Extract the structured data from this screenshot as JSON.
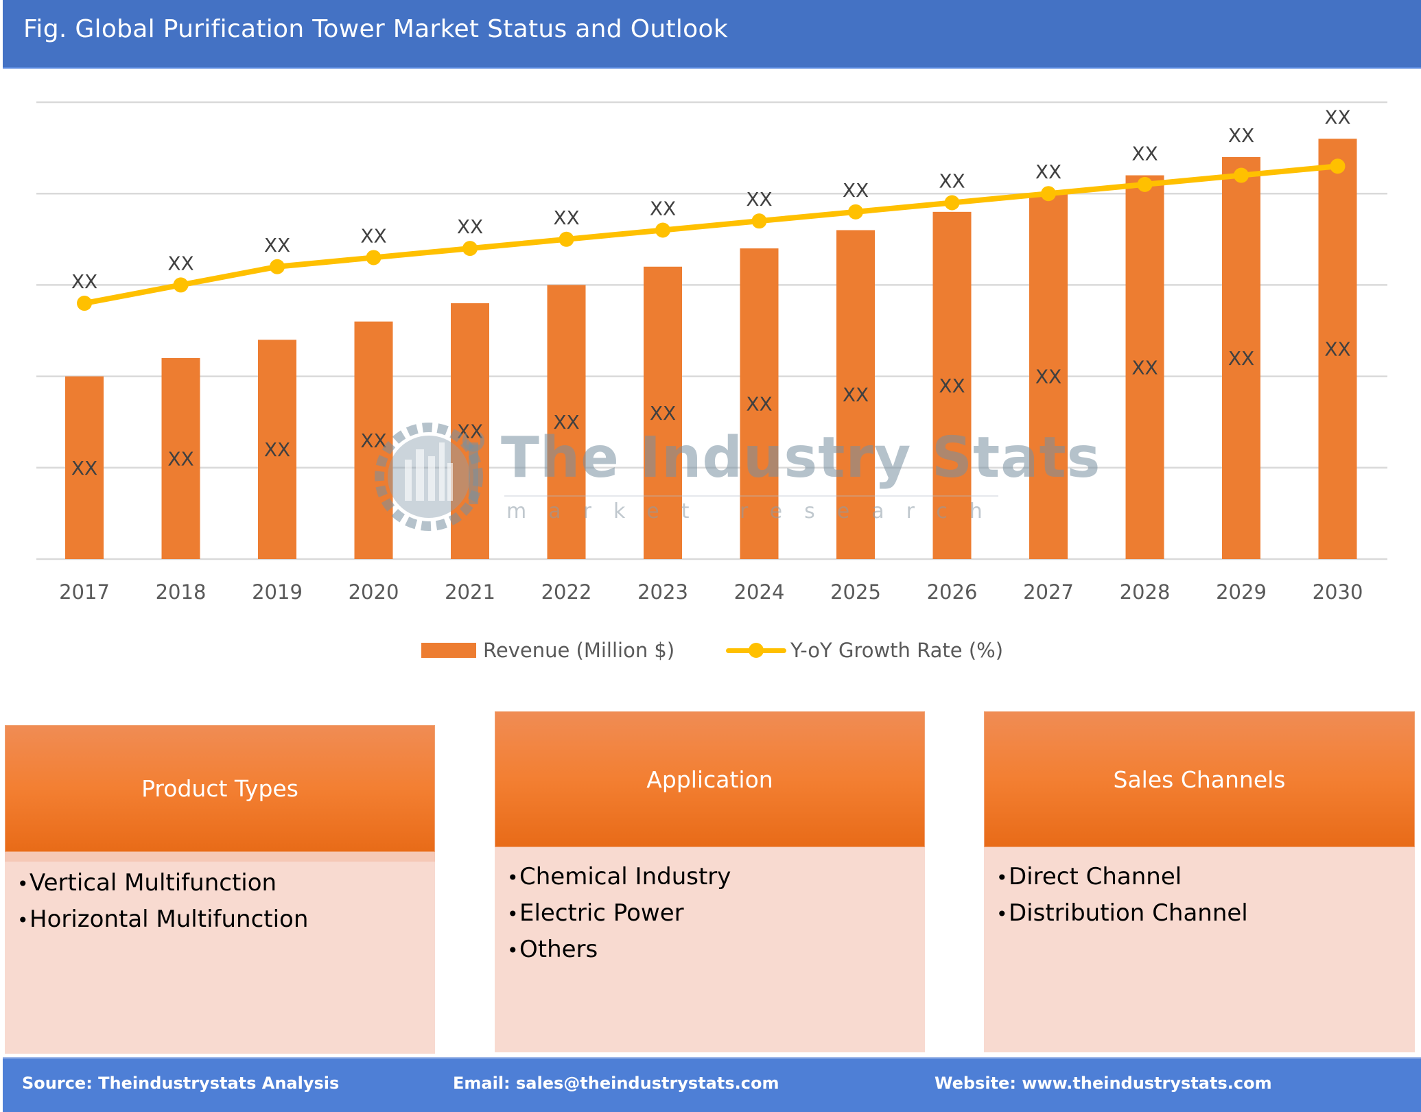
{
  "header": {
    "title": "Fig. Global Purification Tower Market Status and Outlook"
  },
  "chart_data": {
    "type": "bar",
    "title": "Fig. Global Purification Tower Market Status and Outlook",
    "xlabel": "",
    "ylabel": "",
    "categories": [
      "2017",
      "2018",
      "2019",
      "2020",
      "2021",
      "2022",
      "2023",
      "2024",
      "2025",
      "2026",
      "2027",
      "2028",
      "2029",
      "2030"
    ],
    "ylim": [
      0,
      5
    ],
    "grid": true,
    "gridline_count": 6,
    "legend_position": "bottom",
    "series": [
      {
        "name": "Revenue (Million $)",
        "type": "bar",
        "color": "#ed7d31",
        "values": [
          2.0,
          2.2,
          2.4,
          2.6,
          2.8,
          3.0,
          3.2,
          3.4,
          3.6,
          3.8,
          4.0,
          4.2,
          4.4,
          4.6
        ],
        "data_labels": [
          "XX",
          "XX",
          "XX",
          "XX",
          "XX",
          "XX",
          "XX",
          "XX",
          "XX",
          "XX",
          "XX",
          "XX",
          "XX",
          "XX"
        ]
      },
      {
        "name": "Y-oY Growth Rate (%)",
        "type": "line",
        "color": "#ffc000",
        "values": [
          2.8,
          3.0,
          3.2,
          3.3,
          3.4,
          3.5,
          3.6,
          3.7,
          3.8,
          3.9,
          4.0,
          4.1,
          4.2,
          4.3
        ],
        "data_labels": [
          "XX",
          "XX",
          "XX",
          "XX",
          "XX",
          "XX",
          "XX",
          "XX",
          "XX",
          "XX",
          "XX",
          "XX",
          "XX",
          "XX"
        ]
      }
    ],
    "note": "Values are relative estimates read from gridlines; the chart prints placeholder labels 'XX' instead of numbers and shows no y-axis tick labels."
  },
  "watermark": {
    "title": "The Industry Stats",
    "subtitle": "market research",
    "icon": "gear-wrench-factory-icon"
  },
  "segments": [
    {
      "title": "Product Types",
      "items": [
        "Vertical Multifunction",
        "Horizontal Multifunction"
      ]
    },
    {
      "title": "Application",
      "items": [
        "Chemical Industry",
        "Electric Power",
        "Others"
      ]
    },
    {
      "title": "Sales Channels",
      "items": [
        "Direct Channel",
        "Distribution Channel"
      ]
    }
  ],
  "bullet": "•",
  "footer": {
    "source": "Source: Theindustrystats Analysis",
    "email": "Email: sales@theindustrystats.com",
    "website": "Website: www.theindustrystats.com"
  },
  "colors": {
    "header_bg": "#4472c4",
    "footer_bg": "#4e7fd6",
    "bar": "#ed7d31",
    "line": "#ffc000",
    "segment_body": "#f8dad0"
  }
}
